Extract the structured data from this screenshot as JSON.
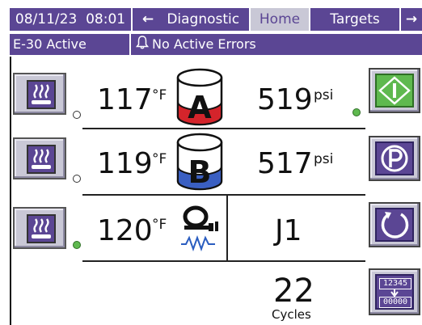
{
  "header": {
    "datetime": "08/11/23  08:01",
    "tabs": [
      {
        "label": "Diagnostic",
        "arrow": "←"
      },
      {
        "label": "Home"
      },
      {
        "label": "Targets"
      },
      {
        "label": "",
        "arrow": "→"
      }
    ]
  },
  "status": {
    "mode": "E-30 Active",
    "errors": "No Active Errors"
  },
  "rows": [
    {
      "temp": "117",
      "temp_unit": "°F",
      "tank_letter": "A",
      "pressure": "519",
      "pressure_unit": "psi",
      "heat_active": false
    },
    {
      "temp": "119",
      "temp_unit": "°F",
      "tank_letter": "B",
      "pressure": "517",
      "pressure_unit": "psi",
      "heat_active": false
    },
    {
      "temp": "120",
      "temp_unit": "°F",
      "hose_code": "J1",
      "heat_active": true
    }
  ],
  "pump_status_on": true,
  "cycles": {
    "count": "22",
    "label": "Cycles"
  },
  "reset_counter": {
    "top": "12345",
    "bottom": "00000"
  },
  "colors": {
    "accent": "#5b4694",
    "tab_active_bg": "#c9c8d6",
    "tank_a": "#d4242b",
    "tank_b": "#3a5fc2",
    "indicator_on": "#5fb94f",
    "start_button": "#5fb94f"
  }
}
